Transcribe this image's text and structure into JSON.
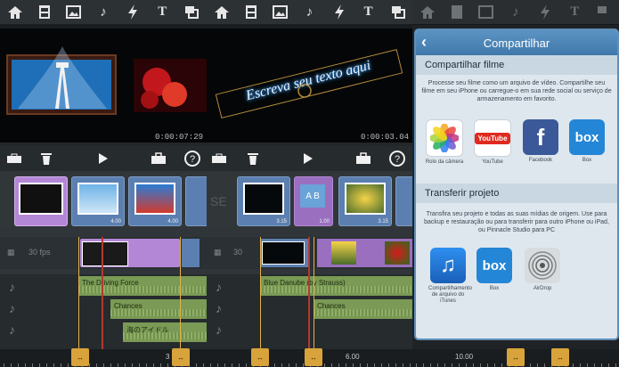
{
  "panel1": {
    "timecode": "0:00:07:29",
    "clip_durations": [
      "",
      "4.00",
      "4.00"
    ],
    "fps_label": "30 fps",
    "audio_tracks": [
      "The Driving Force",
      "Chances",
      "海のアイドル"
    ],
    "ruler_label": "3"
  },
  "panel2": {
    "title_text": "Escreva seu texto aqui",
    "timecode": "0:00:03.04",
    "clip_durations": [
      "3.15",
      "1.00",
      "3.15"
    ],
    "clip_labels": [
      "SE",
      "A B"
    ],
    "fps_label": "30",
    "audio_tracks": [
      "Blue Danube (by Strauss)",
      "Chances"
    ],
    "ruler_label": "6.00"
  },
  "panel3": {
    "ruler_label": "10.00"
  },
  "share": {
    "title": "Compartilhar",
    "section1_title": "Compartilhar filme",
    "section1_desc": "Processe seu filme como um arquivo de vídeo. Compartilhe seu filme em seu iPhone ou carregue-o em sua rede social ou serviço de armazenamento em favorito.",
    "apps1": [
      {
        "label": "Rolo da câmera",
        "icon": "photos-icon"
      },
      {
        "label": "YouTube",
        "icon": "youtube-icon"
      },
      {
        "label": "Facebook",
        "icon": "facebook-icon"
      },
      {
        "label": "Box",
        "icon": "box-icon"
      }
    ],
    "youtube_logo": "YouTube",
    "facebook_logo": "f",
    "box_logo": "box",
    "section2_title": "Transferir projeto",
    "section2_desc": "Transfira seu projeto e todas as suas mídias de origem. Use para backup e restauração ou para transferir para outro iPhone ou iPad, ou Pinnacle Studio para PC",
    "apps2": [
      {
        "label": "Compartilhamento de arquivo do iTunes",
        "icon": "itunes-icon"
      },
      {
        "label": "Box",
        "icon": "box-icon"
      },
      {
        "label": "AirDrop",
        "icon": "airdrop-icon"
      }
    ]
  },
  "colors": {
    "accent": "#5c93c3",
    "clip": "#5b7fb0",
    "selected_clip": "#b487d6",
    "audio": "#7a9a55",
    "handle": "#d8a33a"
  }
}
